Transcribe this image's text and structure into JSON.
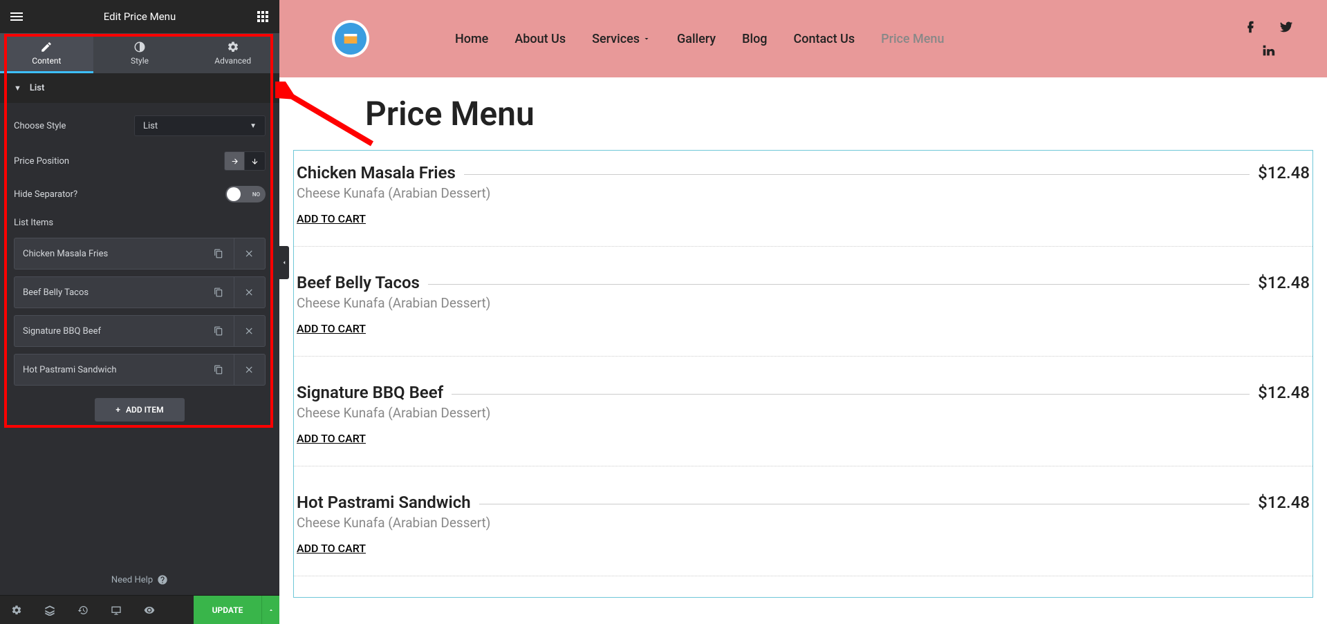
{
  "panel": {
    "title": "Edit Price Menu",
    "tabs": {
      "content": "Content",
      "style": "Style",
      "advanced": "Advanced"
    },
    "section": "List",
    "controls": {
      "choose_style_label": "Choose Style",
      "choose_style_value": "List",
      "price_position_label": "Price Position",
      "hide_separator_label": "Hide Separator?",
      "hide_separator_value": "NO",
      "list_items_label": "List Items"
    },
    "items": [
      {
        "title": "Chicken Masala Fries"
      },
      {
        "title": "Beef Belly Tacos"
      },
      {
        "title": "Signature BBQ Beef"
      },
      {
        "title": "Hot Pastrami Sandwich"
      }
    ],
    "add_item": "ADD ITEM",
    "need_help": "Need Help",
    "update": "UPDATE"
  },
  "site": {
    "nav": {
      "home": "Home",
      "about": "About Us",
      "services": "Services",
      "gallery": "Gallery",
      "blog": "Blog",
      "contact": "Contact Us",
      "price_menu": "Price Menu"
    },
    "page_title": "Price Menu",
    "menu_items": [
      {
        "name": "Chicken Masala Fries",
        "desc": "Cheese Kunafa (Arabian Dessert)",
        "price": "$12.48",
        "cart": "ADD TO CART"
      },
      {
        "name": "Beef Belly Tacos",
        "desc": "Cheese Kunafa (Arabian Dessert)",
        "price": "$12.48",
        "cart": "ADD TO CART"
      },
      {
        "name": "Signature BBQ Beef",
        "desc": "Cheese Kunafa (Arabian Dessert)",
        "price": "$12.48",
        "cart": "ADD TO CART"
      },
      {
        "name": "Hot Pastrami Sandwich",
        "desc": "Cheese Kunafa (Arabian Dessert)",
        "price": "$12.48",
        "cart": "ADD TO CART"
      }
    ]
  }
}
